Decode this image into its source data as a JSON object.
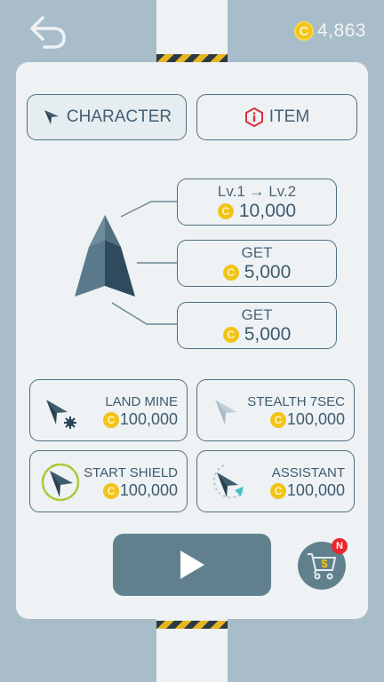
{
  "header": {
    "back_icon": "undo-arrow-icon",
    "coin_symbol": "C",
    "coin_balance": "4,863"
  },
  "tabs": [
    {
      "label": "CHARACTER",
      "icon": "plane-arrow-icon",
      "selected": true
    },
    {
      "label": "ITEM",
      "icon": "info-hexagon-icon",
      "selected": false
    }
  ],
  "upgrades": [
    {
      "line1": "Lv.1 → Lv.2",
      "price": "10,000"
    },
    {
      "line1": "GET",
      "price": "5,000"
    },
    {
      "line1": "GET",
      "price": "5,000"
    }
  ],
  "skills": [
    {
      "label": "LAND MINE",
      "price": "100,000",
      "icon": "land-mine-icon"
    },
    {
      "label": "STEALTH 7SEC",
      "price": "100,000",
      "icon": "stealth-icon"
    },
    {
      "label": "START SHIELD",
      "price": "100,000",
      "icon": "shield-icon"
    },
    {
      "label": "ASSISTANT",
      "price": "100,000",
      "icon": "assistant-icon"
    }
  ],
  "actions": {
    "play_icon": "play-icon",
    "shop_icon": "shopping-cart-icon",
    "shop_badge": "N"
  },
  "colors": {
    "background": "#a9bcc9",
    "panel": "#eef2f4",
    "primary": "#61808e",
    "coin": "#f2c417",
    "badge": "#e8282e",
    "hazard_yellow": "#e7b521"
  }
}
